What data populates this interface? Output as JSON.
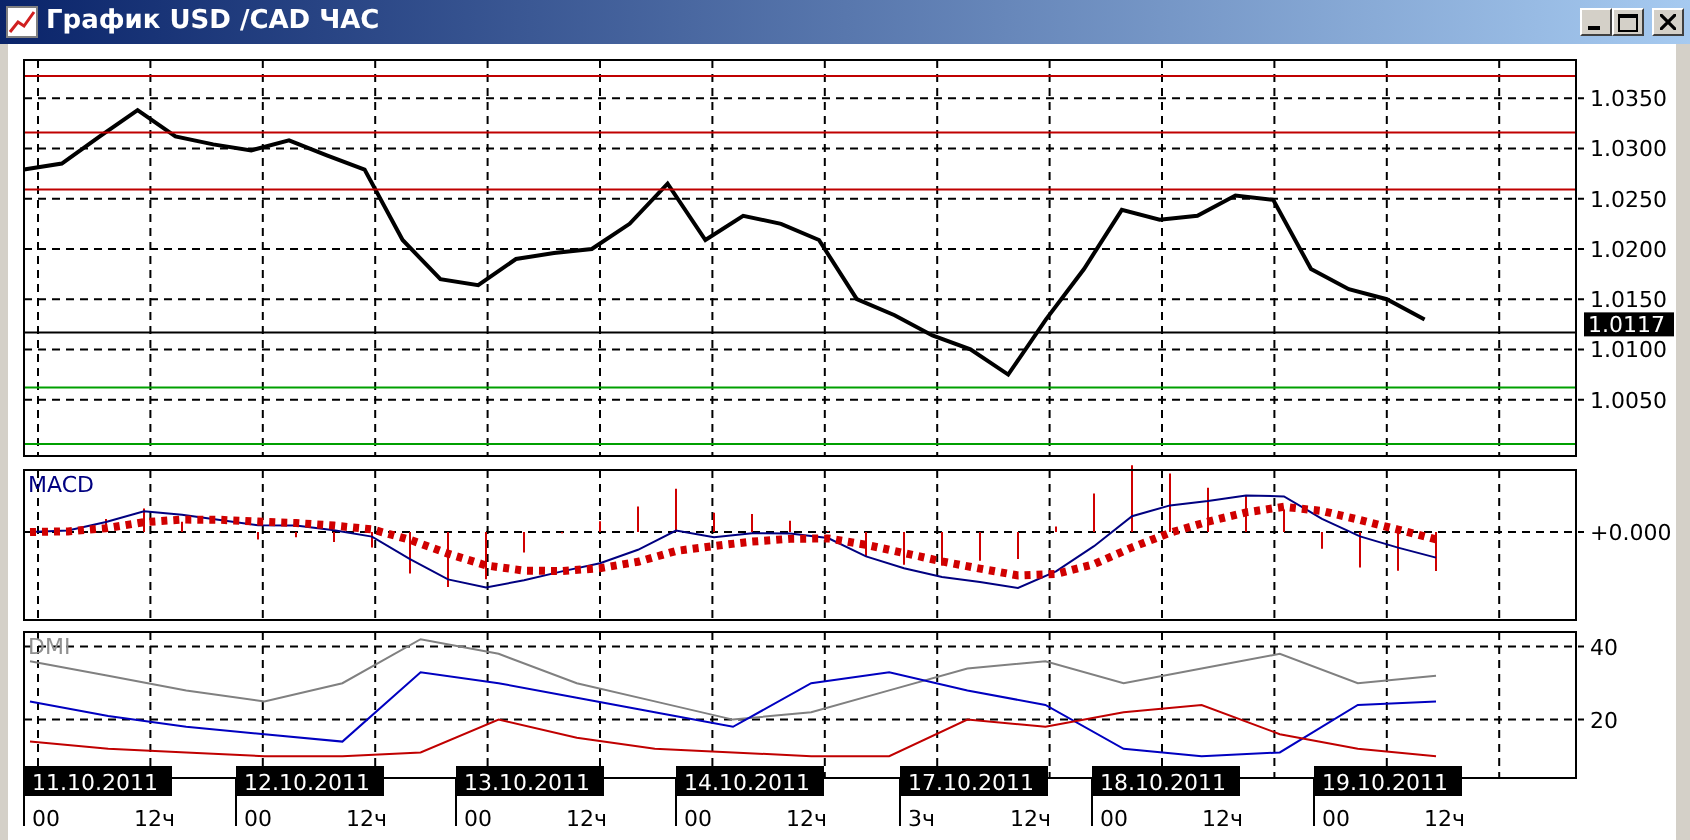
{
  "window": {
    "title": "График USD /CAD  ЧАС"
  },
  "price_panel": {
    "current_price": "1.0117",
    "chart_data": {
      "type": "line",
      "ylim": [
        0.9994,
        1.0388
      ],
      "grid": true,
      "series": [
        {
          "color": "#000000",
          "values": [
            1.0279,
            1.0285,
            1.0312,
            1.0338,
            1.0312,
            1.0304,
            1.0298,
            1.0308,
            1.0293,
            1.0279,
            1.0209,
            1.017,
            1.0164,
            1.019,
            1.0196,
            1.02,
            1.0225,
            1.0265,
            1.0209,
            1.0233,
            1.0225,
            1.0209,
            1.015,
            1.0134,
            1.0114,
            1.01,
            1.0075,
            1.013,
            1.018,
            1.0239,
            1.0229,
            1.0233,
            1.0253,
            1.0249,
            1.018,
            1.016,
            1.015,
            1.013,
            null,
            null,
            null,
            null
          ]
        },
        {
          "color": "#c00000",
          "values": [
            1.0372,
            1.0372,
            1.0372,
            1.0372,
            1.0372,
            1.0372,
            1.0372,
            1.0372,
            1.0372,
            1.0372,
            1.0372,
            1.0372,
            1.0372,
            1.0372,
            1.0372,
            1.0372,
            1.0372,
            1.0372,
            1.0372,
            1.0372,
            1.0372,
            1.0372,
            1.0372,
            1.0372,
            1.0372,
            1.0372,
            1.0372,
            1.0372,
            1.0372,
            1.0372,
            1.0372,
            1.0372,
            1.0372,
            1.0372,
            1.0372,
            1.0372,
            1.0372,
            1.0372,
            1.0372,
            1.0372,
            1.0372,
            1.0372
          ]
        },
        {
          "color": "#c00000",
          "values": [
            1.0316,
            1.0316,
            1.0316,
            1.0316,
            1.0316,
            1.0316,
            1.0316,
            1.0316,
            1.0316,
            1.0316,
            1.0316,
            1.0316,
            1.0316,
            1.0316,
            1.0316,
            1.0316,
            1.0316,
            1.0316,
            1.0316,
            1.0316,
            1.0316,
            1.0316,
            1.0316,
            1.0316,
            1.0316,
            1.0316,
            1.0316,
            1.0316,
            1.0316,
            1.0316,
            1.0316,
            1.0316,
            1.0316,
            1.0316,
            1.0316,
            1.0316,
            1.0316,
            1.0316,
            1.0316,
            1.0316,
            1.0316,
            1.0316
          ]
        },
        {
          "color": "#c00000",
          "values": [
            1.0259,
            1.0259,
            1.0259,
            1.0259,
            1.0259,
            1.0259,
            1.0259,
            1.0259,
            1.0259,
            1.0259,
            1.0259,
            1.0259,
            1.0259,
            1.0259,
            1.0259,
            1.0259,
            1.0259,
            1.0259,
            1.0259,
            1.0259,
            1.0259,
            1.0259,
            1.0259,
            1.0259,
            1.0259,
            1.0259,
            1.0259,
            1.0259,
            1.0259,
            1.0259,
            1.0259,
            1.0259,
            1.0259,
            1.0259,
            1.0259,
            1.0259,
            1.0259,
            1.0259,
            1.0259,
            1.0259,
            1.0259,
            1.0259
          ]
        },
        {
          "color": "#000000",
          "values": [
            1.0117,
            1.0117,
            1.0117,
            1.0117,
            1.0117,
            1.0117,
            1.0117,
            1.0117,
            1.0117,
            1.0117,
            1.0117,
            1.0117,
            1.0117,
            1.0117,
            1.0117,
            1.0117,
            1.0117,
            1.0117,
            1.0117,
            1.0117,
            1.0117,
            1.0117,
            1.0117,
            1.0117,
            1.0117,
            1.0117,
            1.0117,
            1.0117,
            1.0117,
            1.0117,
            1.0117,
            1.0117,
            1.0117,
            1.0117,
            1.0117,
            1.0117,
            1.0117,
            1.0117,
            1.0117,
            1.0117,
            1.0117,
            1.0117
          ]
        },
        {
          "color": "#00a000",
          "values": [
            1.0062,
            1.0062,
            1.0062,
            1.0062,
            1.0062,
            1.0062,
            1.0062,
            1.0062,
            1.0062,
            1.0062,
            1.0062,
            1.0062,
            1.0062,
            1.0062,
            1.0062,
            1.0062,
            1.0062,
            1.0062,
            1.0062,
            1.0062,
            1.0062,
            1.0062,
            1.0062,
            1.0062,
            1.0062,
            1.0062,
            1.0062,
            1.0062,
            1.0062,
            1.0062,
            1.0062,
            1.0062,
            1.0062,
            1.0062,
            1.0062,
            1.0062,
            1.0062,
            1.0062,
            1.0062,
            1.0062,
            1.0062,
            1.0062
          ]
        },
        {
          "color": "#00a000",
          "values": [
            1.0006,
            1.0006,
            1.0006,
            1.0006,
            1.0006,
            1.0006,
            1.0006,
            1.0006,
            1.0006,
            1.0006,
            1.0006,
            1.0006,
            1.0006,
            1.0006,
            1.0006,
            1.0006,
            1.0006,
            1.0006,
            1.0006,
            1.0006,
            1.0006,
            1.0006,
            1.0006,
            1.0006,
            1.0006,
            1.0006,
            1.0006,
            1.0006,
            1.0006,
            1.0006,
            1.0006,
            1.0006,
            1.0006,
            1.0006,
            1.0006,
            1.0006,
            1.0006,
            1.0006,
            1.0006,
            1.0006,
            1.0006,
            1.0006
          ]
        }
      ],
      "yticks": [
        {
          "value": 1.035,
          "label": "1.0350"
        },
        {
          "value": 1.03,
          "label": "1.0300"
        },
        {
          "value": 1.025,
          "label": "1.0250"
        },
        {
          "value": 1.02,
          "label": "1.0200"
        },
        {
          "value": 1.015,
          "label": "1.0150"
        },
        {
          "value": 1.01,
          "label": "1.0100"
        },
        {
          "value": 1.005,
          "label": "1.0050"
        }
      ]
    }
  },
  "macd_panel": {
    "label": "MACD",
    "zero_label": "+0.000"
  },
  "dmi_panel": {
    "label": "DMI",
    "chart_data": {
      "type": "line",
      "ylim": [
        4,
        44
      ],
      "yticks": [
        20,
        40
      ],
      "grid": true,
      "series": [
        {
          "color": "#808080",
          "values": [
            36,
            32,
            28,
            25,
            30,
            42,
            38,
            30,
            25,
            20,
            22,
            28,
            34,
            36,
            30,
            34,
            38,
            30,
            32
          ]
        },
        {
          "color": "#0000c0",
          "values": [
            25,
            21,
            18,
            16,
            14,
            33,
            30,
            26,
            22,
            18,
            30,
            33,
            28,
            24,
            12,
            10,
            11,
            24,
            25
          ]
        },
        {
          "color": "#c00000",
          "values": [
            14,
            12,
            11,
            10,
            10,
            11,
            20,
            15,
            12,
            11,
            10,
            10,
            20,
            18,
            22,
            24,
            16,
            12,
            10
          ]
        }
      ]
    }
  },
  "time_axis": [
    {
      "date": "11.10.2011",
      "hours": [
        "00",
        "12ч"
      ]
    },
    {
      "date": "12.10.2011",
      "hours": [
        "00",
        "12ч"
      ]
    },
    {
      "date": "13.10.2011",
      "hours": [
        "00",
        "12ч"
      ]
    },
    {
      "date": "14.10.2011",
      "hours": [
        "00",
        "12ч"
      ]
    },
    {
      "date": "17.10.2011",
      "hours": [
        "3ч",
        "12ч"
      ]
    },
    {
      "date": "18.10.2011",
      "hours": [
        "00",
        "12ч"
      ]
    },
    {
      "date": "19.10.2011",
      "hours": [
        "00",
        "12ч"
      ]
    }
  ]
}
